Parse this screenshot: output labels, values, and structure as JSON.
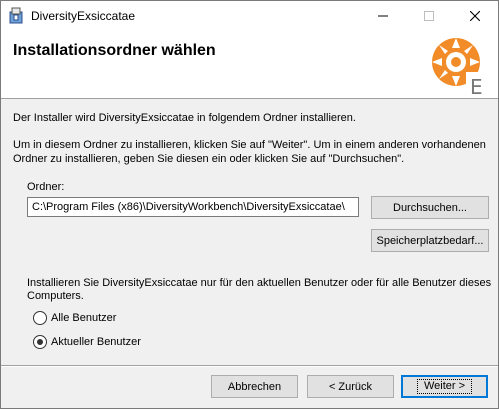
{
  "window": {
    "title": "DiversityExsiccatae",
    "icon": "installer-package-icon",
    "controls": [
      "minimize-icon",
      "maximize-icon",
      "close-icon"
    ]
  },
  "header": {
    "title": "Installationsordner wählen",
    "logo": "diversity-workbench-logo"
  },
  "body": {
    "intro": "Der Installer wird DiversityExsiccatae in folgendem Ordner installieren.",
    "instructions_line1": "Um in diesem Ordner zu installieren, klicken Sie auf \"Weiter\". Um in einem anderen vorhandenen",
    "instructions_line2": "Ordner zu installieren, geben Sie diesen ein oder klicken Sie auf \"Durchsuchen\"."
  },
  "folder": {
    "label": "Ordner:",
    "path": "C:\\Program Files (x86)\\DiversityWorkbench\\DiversityExsiccatae\\",
    "browse_button": "Durchsuchen...",
    "disk_cost_button": "Speicherplatzbedarf..."
  },
  "install_for": {
    "question_line1": "Installieren Sie DiversityExsiccatae nur für den aktuellen Benutzer oder für alle Benutzer dieses",
    "question_line2": "Computers.",
    "options": [
      {
        "label": "Alle Benutzer",
        "checked": false
      },
      {
        "label": "Aktueller Benutzer",
        "checked": true
      }
    ]
  },
  "footer": {
    "cancel": "Abbrechen",
    "back": "< Zurück",
    "next": "Weiter >"
  }
}
